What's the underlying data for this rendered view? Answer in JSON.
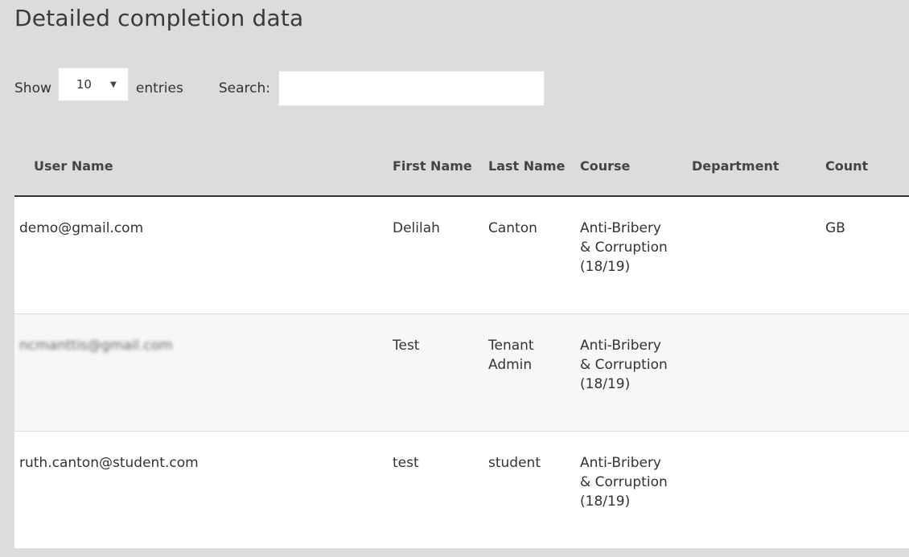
{
  "page": {
    "title": "Detailed completion data"
  },
  "controls": {
    "show_label": "Show",
    "length_value": "10",
    "entries_label": "entries",
    "search_label": "Search:",
    "search_value": "",
    "caret_icon": "triangle-down"
  },
  "table": {
    "columns": [
      {
        "label": "User Name"
      },
      {
        "label": "First Name"
      },
      {
        "label": "Last Name"
      },
      {
        "label": "Course"
      },
      {
        "label": "Department"
      },
      {
        "label": "Count"
      }
    ],
    "rows": [
      {
        "user_name": "demo@gmail.com",
        "first_name": "Delilah",
        "last_name": "Canton",
        "course": "Anti-Bribery & Corruption (18/19)",
        "department": "",
        "country": "GB"
      },
      {
        "user_name": "ncmanttis@gmail.com",
        "first_name": "Test",
        "last_name": "Tenant Admin",
        "course": "Anti-Bribery & Corruption (18/19)",
        "department": "",
        "country": ""
      },
      {
        "user_name": "ruth.canton@student.com",
        "first_name": "test",
        "last_name": "student",
        "course": "Anti-Bribery & Corruption (18/19)",
        "department": "",
        "country": ""
      }
    ]
  }
}
